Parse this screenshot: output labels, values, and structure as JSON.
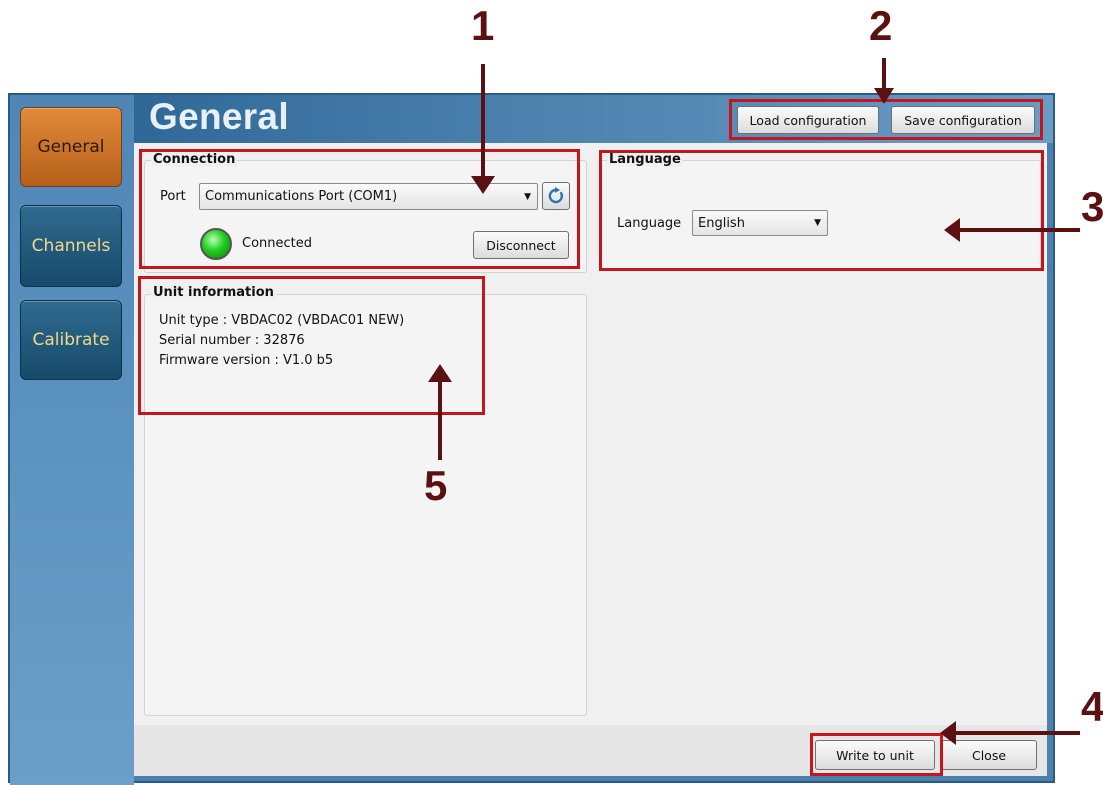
{
  "sidebar": {
    "items": [
      {
        "label": "General",
        "active": true
      },
      {
        "label": "Channels",
        "active": false
      },
      {
        "label": "Calibrate",
        "active": false
      }
    ]
  },
  "header": {
    "title": "General",
    "load_label": "Load configuration",
    "save_label": "Save configuration"
  },
  "connection": {
    "group_title": "Connection",
    "port_label": "Port",
    "port_value": "Communications Port (COM1)",
    "status_text": "Connected",
    "status_color": "#22cc22",
    "disconnect_label": "Disconnect",
    "refresh_icon": "refresh-icon"
  },
  "language": {
    "group_title": "Language",
    "label": "Language",
    "value": "English"
  },
  "unit_info": {
    "group_title": "Unit information",
    "lines": [
      "Unit type : VBDAC02 (VBDAC01 NEW)",
      "Serial number : 32876",
      "Firmware version : V1.0 b5"
    ]
  },
  "footer": {
    "write_label": "Write to unit",
    "close_label": "Close"
  },
  "annotations": {
    "color": "#c4161c",
    "arrow_color": "#5b1112",
    "labels": [
      "1",
      "2",
      "3",
      "4",
      "5"
    ]
  }
}
